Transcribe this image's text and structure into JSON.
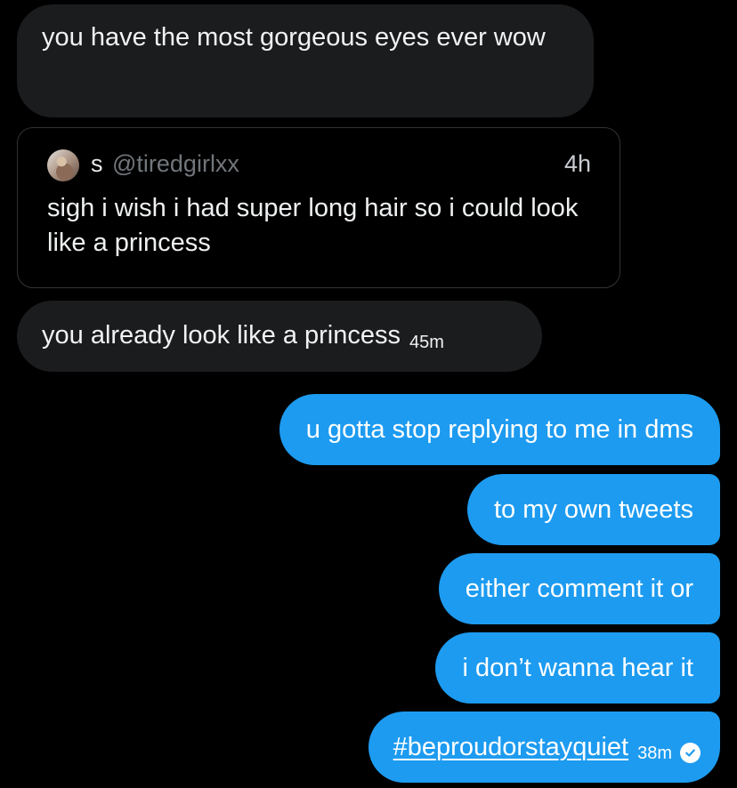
{
  "colors": {
    "background": "#000000",
    "incoming_bubble": "#1b1c1e",
    "outgoing_bubble": "#1d9bf0",
    "quote_border": "#2f3336",
    "muted_text": "#71767b"
  },
  "incoming": {
    "message_1": "you have the most gorgeous eyes ever wow",
    "message_2": "you already look like a princess",
    "message_2_time": "45m"
  },
  "quoted_tweet": {
    "avatar_icon": "user-avatar",
    "name": "s",
    "handle": "@tiredgirlxx",
    "time": "4h",
    "text": "sigh i wish i had super long hair so i could look like a princess"
  },
  "outgoing": {
    "message_1": "u gotta stop replying to me in dms",
    "message_2": "to my own tweets",
    "message_3": "either comment it or",
    "message_4": "i don’t wanna hear it",
    "message_5": "#beproudorstayquiet",
    "message_5_time": "38m",
    "status_icon": "check-circle-icon"
  }
}
